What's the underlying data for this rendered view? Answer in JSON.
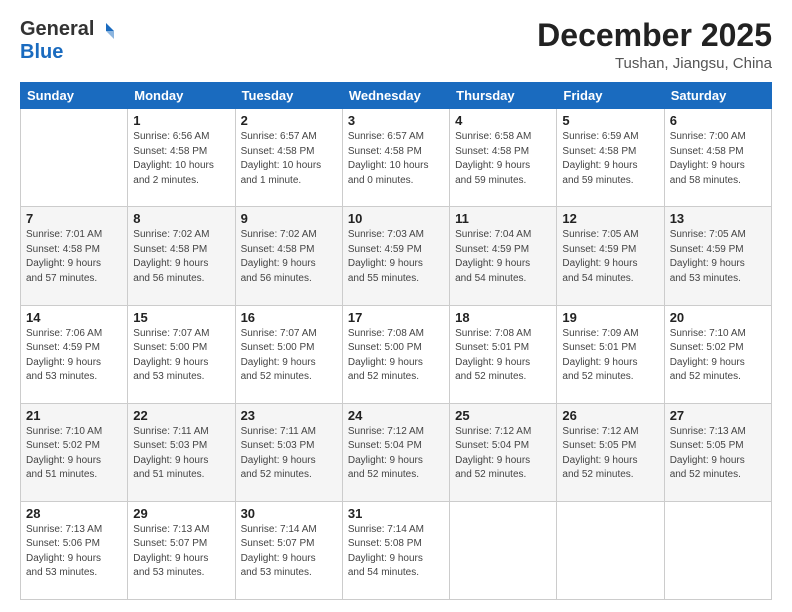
{
  "header": {
    "logo_general": "General",
    "logo_blue": "Blue",
    "month": "December 2025",
    "location": "Tushan, Jiangsu, China"
  },
  "days_of_week": [
    "Sunday",
    "Monday",
    "Tuesday",
    "Wednesday",
    "Thursday",
    "Friday",
    "Saturday"
  ],
  "weeks": [
    [
      {
        "day": "",
        "info": ""
      },
      {
        "day": "1",
        "info": "Sunrise: 6:56 AM\nSunset: 4:58 PM\nDaylight: 10 hours\nand 2 minutes."
      },
      {
        "day": "2",
        "info": "Sunrise: 6:57 AM\nSunset: 4:58 PM\nDaylight: 10 hours\nand 1 minute."
      },
      {
        "day": "3",
        "info": "Sunrise: 6:57 AM\nSunset: 4:58 PM\nDaylight: 10 hours\nand 0 minutes."
      },
      {
        "day": "4",
        "info": "Sunrise: 6:58 AM\nSunset: 4:58 PM\nDaylight: 9 hours\nand 59 minutes."
      },
      {
        "day": "5",
        "info": "Sunrise: 6:59 AM\nSunset: 4:58 PM\nDaylight: 9 hours\nand 59 minutes."
      },
      {
        "day": "6",
        "info": "Sunrise: 7:00 AM\nSunset: 4:58 PM\nDaylight: 9 hours\nand 58 minutes."
      }
    ],
    [
      {
        "day": "7",
        "info": "Sunrise: 7:01 AM\nSunset: 4:58 PM\nDaylight: 9 hours\nand 57 minutes."
      },
      {
        "day": "8",
        "info": "Sunrise: 7:02 AM\nSunset: 4:58 PM\nDaylight: 9 hours\nand 56 minutes."
      },
      {
        "day": "9",
        "info": "Sunrise: 7:02 AM\nSunset: 4:58 PM\nDaylight: 9 hours\nand 56 minutes."
      },
      {
        "day": "10",
        "info": "Sunrise: 7:03 AM\nSunset: 4:59 PM\nDaylight: 9 hours\nand 55 minutes."
      },
      {
        "day": "11",
        "info": "Sunrise: 7:04 AM\nSunset: 4:59 PM\nDaylight: 9 hours\nand 54 minutes."
      },
      {
        "day": "12",
        "info": "Sunrise: 7:05 AM\nSunset: 4:59 PM\nDaylight: 9 hours\nand 54 minutes."
      },
      {
        "day": "13",
        "info": "Sunrise: 7:05 AM\nSunset: 4:59 PM\nDaylight: 9 hours\nand 53 minutes."
      }
    ],
    [
      {
        "day": "14",
        "info": "Sunrise: 7:06 AM\nSunset: 4:59 PM\nDaylight: 9 hours\nand 53 minutes."
      },
      {
        "day": "15",
        "info": "Sunrise: 7:07 AM\nSunset: 5:00 PM\nDaylight: 9 hours\nand 53 minutes."
      },
      {
        "day": "16",
        "info": "Sunrise: 7:07 AM\nSunset: 5:00 PM\nDaylight: 9 hours\nand 52 minutes."
      },
      {
        "day": "17",
        "info": "Sunrise: 7:08 AM\nSunset: 5:00 PM\nDaylight: 9 hours\nand 52 minutes."
      },
      {
        "day": "18",
        "info": "Sunrise: 7:08 AM\nSunset: 5:01 PM\nDaylight: 9 hours\nand 52 minutes."
      },
      {
        "day": "19",
        "info": "Sunrise: 7:09 AM\nSunset: 5:01 PM\nDaylight: 9 hours\nand 52 minutes."
      },
      {
        "day": "20",
        "info": "Sunrise: 7:10 AM\nSunset: 5:02 PM\nDaylight: 9 hours\nand 52 minutes."
      }
    ],
    [
      {
        "day": "21",
        "info": "Sunrise: 7:10 AM\nSunset: 5:02 PM\nDaylight: 9 hours\nand 51 minutes."
      },
      {
        "day": "22",
        "info": "Sunrise: 7:11 AM\nSunset: 5:03 PM\nDaylight: 9 hours\nand 51 minutes."
      },
      {
        "day": "23",
        "info": "Sunrise: 7:11 AM\nSunset: 5:03 PM\nDaylight: 9 hours\nand 52 minutes."
      },
      {
        "day": "24",
        "info": "Sunrise: 7:12 AM\nSunset: 5:04 PM\nDaylight: 9 hours\nand 52 minutes."
      },
      {
        "day": "25",
        "info": "Sunrise: 7:12 AM\nSunset: 5:04 PM\nDaylight: 9 hours\nand 52 minutes."
      },
      {
        "day": "26",
        "info": "Sunrise: 7:12 AM\nSunset: 5:05 PM\nDaylight: 9 hours\nand 52 minutes."
      },
      {
        "day": "27",
        "info": "Sunrise: 7:13 AM\nSunset: 5:05 PM\nDaylight: 9 hours\nand 52 minutes."
      }
    ],
    [
      {
        "day": "28",
        "info": "Sunrise: 7:13 AM\nSunset: 5:06 PM\nDaylight: 9 hours\nand 53 minutes."
      },
      {
        "day": "29",
        "info": "Sunrise: 7:13 AM\nSunset: 5:07 PM\nDaylight: 9 hours\nand 53 minutes."
      },
      {
        "day": "30",
        "info": "Sunrise: 7:14 AM\nSunset: 5:07 PM\nDaylight: 9 hours\nand 53 minutes."
      },
      {
        "day": "31",
        "info": "Sunrise: 7:14 AM\nSunset: 5:08 PM\nDaylight: 9 hours\nand 54 minutes."
      },
      {
        "day": "",
        "info": ""
      },
      {
        "day": "",
        "info": ""
      },
      {
        "day": "",
        "info": ""
      }
    ]
  ]
}
